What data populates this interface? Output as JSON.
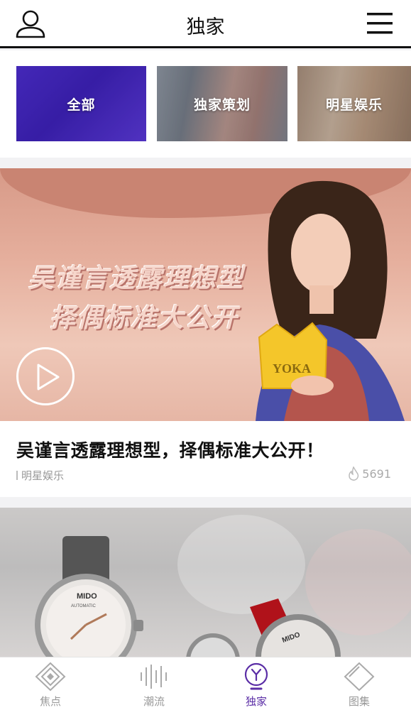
{
  "header": {
    "title": "独家",
    "user_icon": "user-icon",
    "menu_icon": "menu-icon"
  },
  "categories": [
    {
      "label": "全部"
    },
    {
      "label": "独家策划"
    },
    {
      "label": "明星娱乐"
    }
  ],
  "feed": [
    {
      "overlay_line1": "吴谨言透露理想型",
      "overlay_line2": "择偶标准大公开",
      "crown_text": "YOKA",
      "headline": "吴谨言透露理想型，择偶标准大公开！",
      "tag": "明星娱乐",
      "views": "5691",
      "has_video": true
    },
    {
      "brand_text": "MIDO",
      "brand_sub": "AUTOMATIC"
    }
  ],
  "tabbar": {
    "items": [
      {
        "label": "焦点",
        "icon": "diamond-target-icon"
      },
      {
        "label": "潮流",
        "icon": "sound-wave-icon"
      },
      {
        "label": "独家",
        "icon": "yoka-y-icon",
        "active": true
      },
      {
        "label": "图集",
        "icon": "gallery-diamond-icon"
      }
    ]
  },
  "colors": {
    "accent": "#5b2ea6",
    "inactive": "#999999",
    "header_border": "#111111"
  }
}
